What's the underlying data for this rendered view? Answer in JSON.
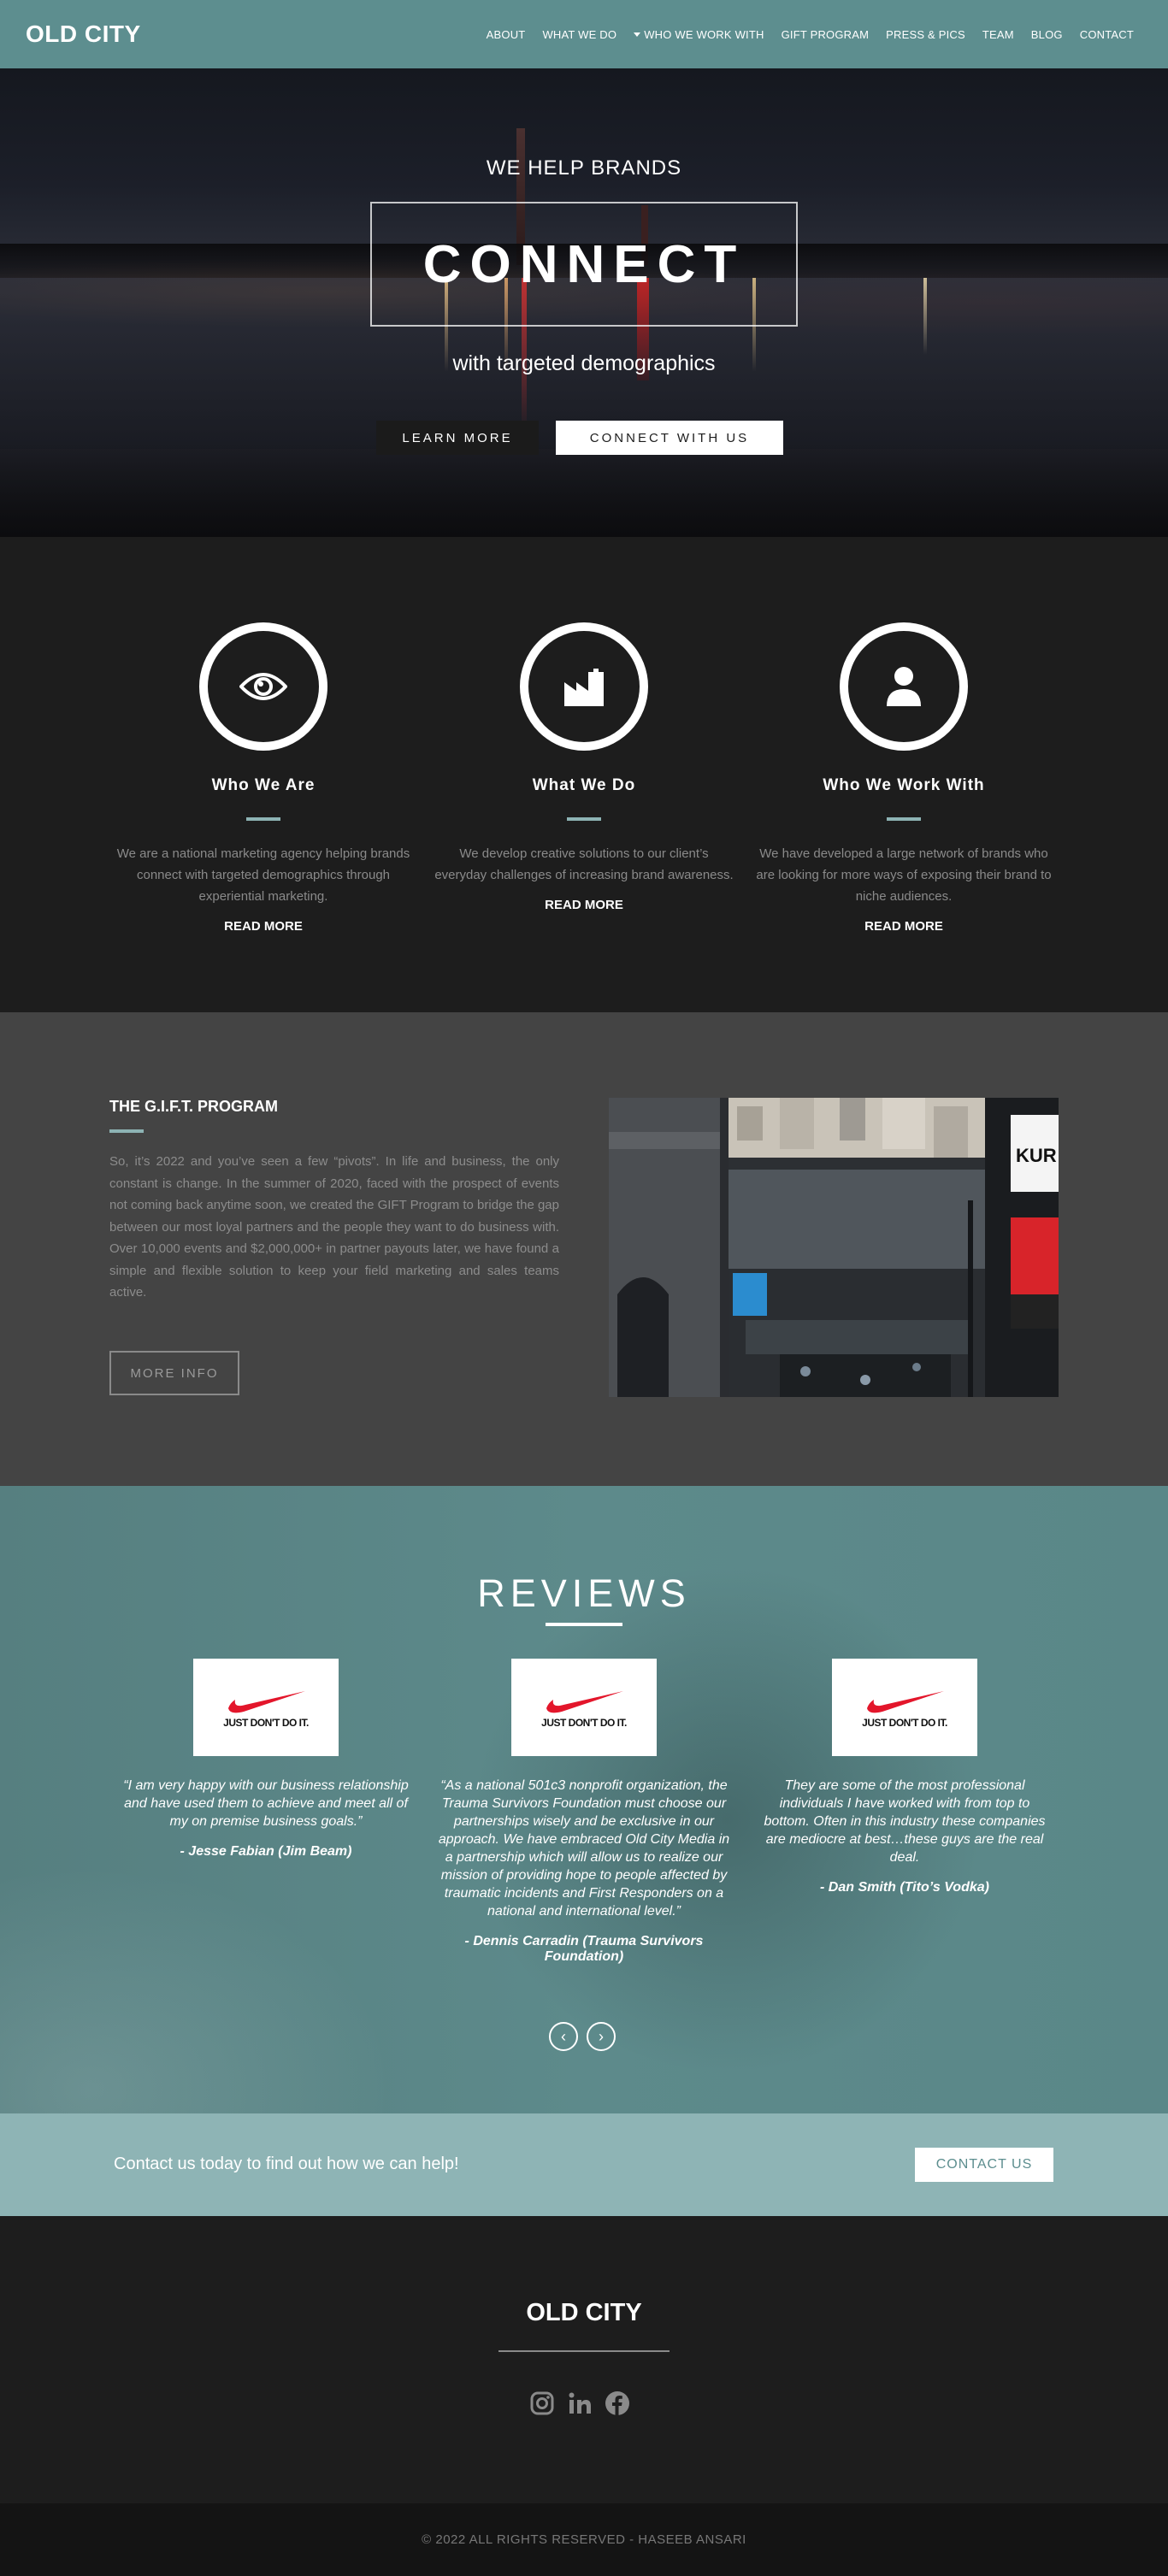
{
  "nav": {
    "brand": "OLD CITY",
    "items": [
      "ABOUT",
      "WHAT WE DO",
      "WHO WE WORK WITH",
      "GIFT PROGRAM",
      "PRESS & PICS",
      "TEAM",
      "BLOG",
      "CONTACT"
    ]
  },
  "hero": {
    "kicker": "WE HELP BRANDS",
    "title": "CONNECT",
    "subtitle": "with targeted demographics",
    "learn_more": "LEARN MORE",
    "connect": "CONNECT WITH US"
  },
  "features": [
    {
      "icon": "eye-icon",
      "title": "Who We Are",
      "text": "We are a national marketing agency helping brands connect with targeted demographics through experiential marketing.",
      "link": "READ MORE"
    },
    {
      "icon": "factory-icon",
      "title": "What We Do",
      "text": "We develop creative solutions to our client’s everyday challenges of increasing brand awareness.",
      "link": "READ MORE"
    },
    {
      "icon": "user-icon",
      "title": "Who We Work With",
      "text": "We have developed a large network of brands who are looking for more ways of exposing their brand to niche audiences.",
      "link": "READ MORE"
    }
  ],
  "gift": {
    "title": "THE G.I.F.T. PROGRAM",
    "text": "So, it’s 2022 and you’ve seen a few “pivots”. In life and business, the only constant is change. In the summer of 2020, faced with the prospect of events not coming back anytime soon, we created the GIFT Program to bridge the gap between our most loyal partners and the people they want to do business with. Over 10,000 events and $2,000,000+ in partner payouts later, we have found a simple and flexible solution to keep your field marketing and sales teams active.",
    "button": "MORE INFO"
  },
  "reviews": {
    "title": "REVIEWS",
    "logo_text": "JUST DON'T DO IT.",
    "items": [
      {
        "quote": "“I am very happy with our business relationship and have used them to achieve and meet all of my on premise business goals.”",
        "author": "- Jesse Fabian (Jim Beam)"
      },
      {
        "quote": "“As a national 501c3 nonprofit organization, the Trauma Survivors Foundation must choose our partnerships wisely and be exclusive in our approach. We have embraced Old City Media in a partnership which will allow us to realize our mission of providing hope to people affected by traumatic incidents and First Responders on a national and international level.”",
        "author": "- Dennis Carradin (Trauma Survivors Foundation)"
      },
      {
        "quote": "They are some of the most professional individuals I have worked with from top to bottom. Often in this industry these companies are mediocre at best…these guys are the real deal.",
        "author": "- Dan Smith (Tito’s Vodka)"
      }
    ],
    "prev": "‹",
    "next": "›"
  },
  "contact_band": {
    "message": "Contact us today to find out how we can help!",
    "button": "CONTACT US"
  },
  "footer": {
    "brand": "OLD CITY",
    "social": [
      "instagram-icon",
      "linkedin-icon",
      "facebook-icon"
    ],
    "copyright": "© 2022 ALL RIGHTS RESERVED - HASEEB ANSARI"
  },
  "colors": {
    "teal": "#5d8e8f",
    "light_teal": "#8eb4b5",
    "dark": "#1d1d1d",
    "gray": "#444444",
    "swoosh_red": "#e3162b"
  }
}
